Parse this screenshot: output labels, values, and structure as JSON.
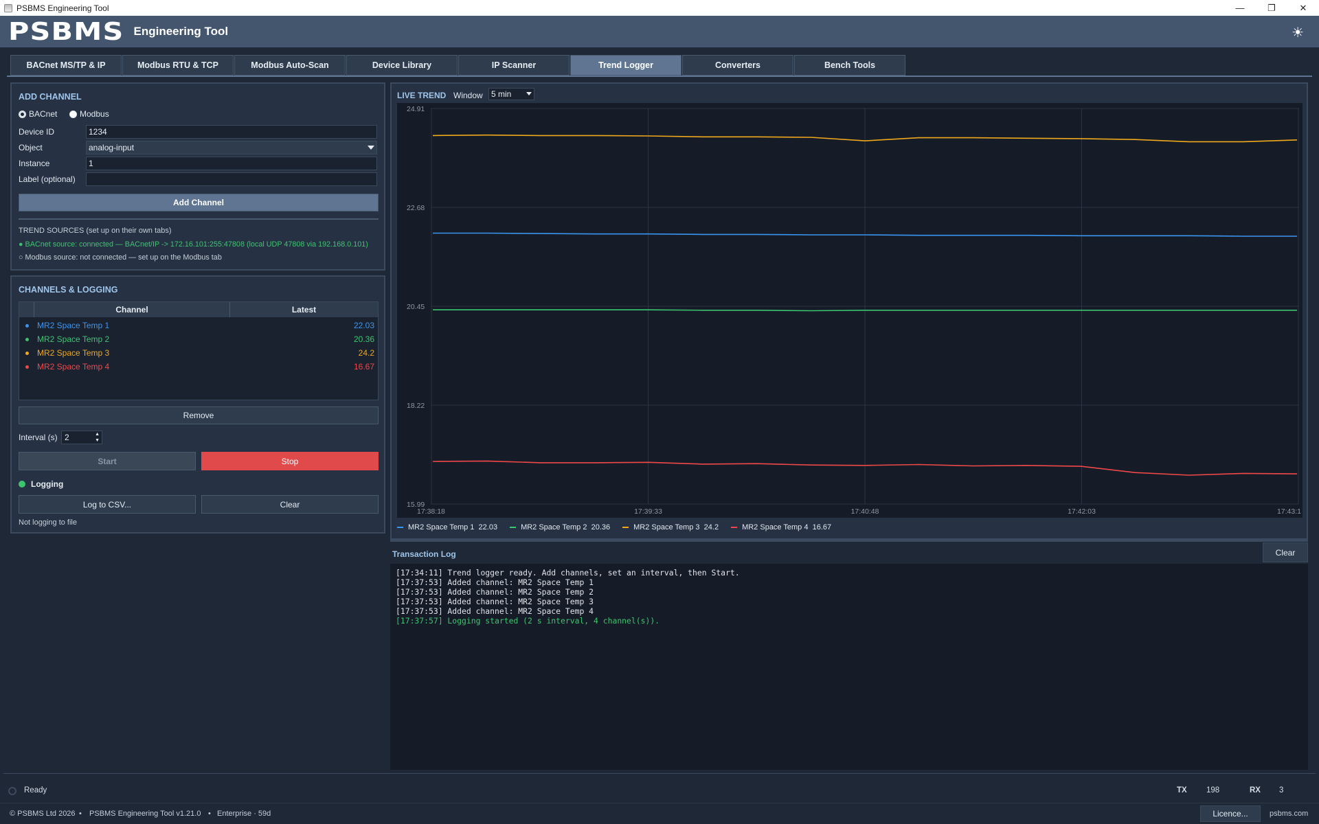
{
  "window": {
    "title": "PSBMS Engineering Tool"
  },
  "header": {
    "logo": "PSBMS",
    "subtitle": "Engineering Tool"
  },
  "tabs": [
    {
      "label": "BACnet MS/TP & IP",
      "active": false
    },
    {
      "label": "Modbus RTU & TCP",
      "active": false
    },
    {
      "label": "Modbus Auto-Scan",
      "active": false
    },
    {
      "label": "Device Library",
      "active": false
    },
    {
      "label": "IP Scanner",
      "active": false
    },
    {
      "label": "Trend Logger",
      "active": true
    },
    {
      "label": "Converters",
      "active": false
    },
    {
      "label": "Bench Tools",
      "active": false
    }
  ],
  "add_channel": {
    "title": "ADD CHANNEL",
    "protocol_options": [
      "BACnet",
      "Modbus"
    ],
    "protocol_selected": "BACnet",
    "device_id_label": "Device ID",
    "device_id_value": "1234",
    "object_label": "Object",
    "object_value": "analog-input",
    "instance_label": "Instance",
    "instance_value": "1",
    "label_label": "Label (optional)",
    "label_value": "",
    "add_button": "Add Channel",
    "sources_title": "TREND SOURCES (set up on their own tabs)",
    "bacnet_source": "● BACnet source: connected — BACnet/IP -> 172.16.101:255:47808 (local UDP 47808 via 192.168.0.101)",
    "modbus_source": "○ Modbus source: not connected — set up on the Modbus tab"
  },
  "channels": {
    "title": "CHANNELS & LOGGING",
    "col_channel": "Channel",
    "col_latest": "Latest",
    "rows": [
      {
        "name": "MR2 Space Temp 1",
        "latest": "22.03",
        "color": "#3a95f0"
      },
      {
        "name": "MR2 Space Temp 2",
        "latest": "20.36",
        "color": "#3cc56e"
      },
      {
        "name": "MR2 Space Temp 3",
        "latest": "24.2",
        "color": "#f0a81c"
      },
      {
        "name": "MR2 Space Temp 4",
        "latest": "16.67",
        "color": "#f04848"
      }
    ],
    "remove_button": "Remove",
    "interval_label": "Interval (s)",
    "interval_value": "2",
    "start_button": "Start",
    "stop_button": "Stop",
    "logging_status": "Logging",
    "log_csv_button": "Log to CSV...",
    "clear_button": "Clear",
    "file_status": "Not logging to file"
  },
  "live_trend": {
    "title": "LIVE TREND",
    "window_label": "Window",
    "window_value": "5 min"
  },
  "chart_data": {
    "type": "line",
    "title": "",
    "xlabel": "",
    "ylabel": "",
    "ylim": [
      15.99,
      24.91
    ],
    "y_ticks": [
      "24.91",
      "22.68",
      "20.45",
      "18.22",
      "15.99"
    ],
    "x_ticks": [
      "17:38:18",
      "17:39:33",
      "17:40:48",
      "17:42:03",
      "17:43:1"
    ],
    "grid": true,
    "legend_position": "bottom",
    "series": [
      {
        "name": "MR2 Space Temp 1",
        "latest": "22.03",
        "color": "#3a95f0",
        "values": [
          22.1,
          22.1,
          22.09,
          22.08,
          22.08,
          22.07,
          22.07,
          22.06,
          22.06,
          22.05,
          22.05,
          22.05,
          22.04,
          22.04,
          22.04,
          22.03,
          22.03
        ]
      },
      {
        "name": "MR2 Space Temp 2",
        "latest": "20.36",
        "color": "#3cc56e",
        "values": [
          20.37,
          20.37,
          20.37,
          20.37,
          20.37,
          20.36,
          20.36,
          20.35,
          20.36,
          20.36,
          20.36,
          20.36,
          20.36,
          20.36,
          20.36,
          20.36,
          20.36
        ]
      },
      {
        "name": "MR2 Space Temp 3",
        "latest": "24.2",
        "color": "#f0a81c",
        "values": [
          24.3,
          24.31,
          24.3,
          24.3,
          24.29,
          24.27,
          24.27,
          24.26,
          24.18,
          24.25,
          24.25,
          24.24,
          24.23,
          24.21,
          24.16,
          24.16,
          24.2
        ]
      },
      {
        "name": "MR2 Space Temp 4",
        "latest": "16.67",
        "color": "#f04848",
        "values": [
          16.95,
          16.96,
          16.92,
          16.92,
          16.93,
          16.89,
          16.9,
          16.87,
          16.86,
          16.88,
          16.85,
          16.86,
          16.84,
          16.7,
          16.64,
          16.68,
          16.67
        ]
      }
    ]
  },
  "log": {
    "title": "Transaction Log",
    "clear_button": "Clear",
    "lines": [
      {
        "text": "[17:34:11] Trend logger ready. Add channels, set an interval, then Start.",
        "ok": false
      },
      {
        "text": "[17:37:53] Added channel: MR2 Space Temp 1",
        "ok": false
      },
      {
        "text": "[17:37:53] Added channel: MR2 Space Temp 2",
        "ok": false
      },
      {
        "text": "[17:37:53] Added channel: MR2 Space Temp 3",
        "ok": false
      },
      {
        "text": "[17:37:53] Added channel: MR2 Space Temp 4",
        "ok": false
      },
      {
        "text": "[17:37:57] Logging started (2 s interval, 4 channel(s)).",
        "ok": true
      }
    ]
  },
  "status": {
    "ready": "Ready",
    "tx_label": "TX",
    "tx_value": "198",
    "rx_label": "RX",
    "rx_value": "3"
  },
  "footer": {
    "copyright": "© PSBMS Ltd 2026",
    "sep": "•",
    "version": "PSBMS Engineering Tool v1.21.0",
    "licence_info": "Enterprise · 59d",
    "licence_button": "Licence...",
    "website": "psbms.com"
  }
}
